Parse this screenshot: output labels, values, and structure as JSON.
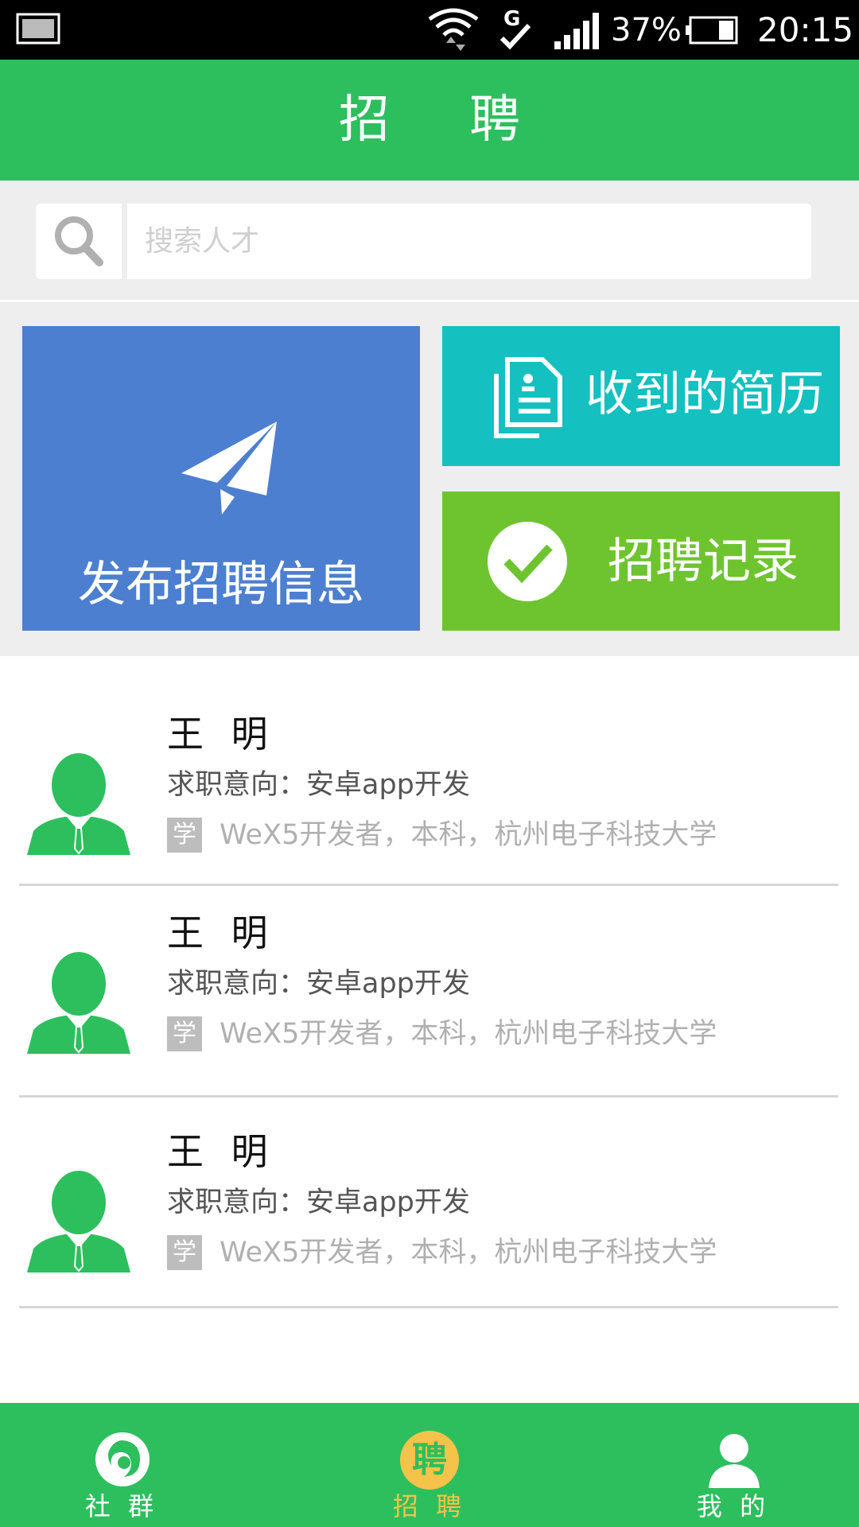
{
  "status_bar": {
    "battery_percent": "37%",
    "time": "20:15",
    "network": "G",
    "icons": [
      "screenshot-icon",
      "wifi-icon",
      "network-g-icon",
      "signal-icon",
      "battery-icon"
    ]
  },
  "header": {
    "title": "招 聘"
  },
  "search": {
    "placeholder": "搜索人才",
    "value": ""
  },
  "actions": {
    "publish": {
      "label": "发布招聘信息",
      "icon": "paper-plane-icon"
    },
    "received_resumes": {
      "label": "收到的简历",
      "icon": "document-icon"
    },
    "records": {
      "label": "招聘记录",
      "icon": "check-circle-icon"
    }
  },
  "candidates": [
    {
      "name": "王 明",
      "intent": "求职意向：安卓app开发",
      "badge": "学",
      "education": "WeX5开发者，本科，杭州电子科技大学"
    },
    {
      "name": "王 明",
      "intent": "求职意向：安卓app开发",
      "badge": "学",
      "education": "WeX5开发者，本科，杭州电子科技大学"
    },
    {
      "name": "王 明",
      "intent": "求职意向：安卓app开发",
      "badge": "学",
      "education": "WeX5开发者，本科，杭州电子科技大学"
    }
  ],
  "bottom_nav": [
    {
      "label": "社 群",
      "icon": "community-icon",
      "active": false
    },
    {
      "label": "招 聘",
      "icon": "recruit-icon",
      "badge_text": "聘",
      "active": true
    },
    {
      "label": "我 的",
      "icon": "profile-icon",
      "active": false
    }
  ],
  "colors": {
    "primary_green": "#2dbf5d",
    "publish_blue": "#4c7fd0",
    "resume_teal": "#14c0c0",
    "record_green": "#6ec42f",
    "active_nav": "#f5c24a"
  }
}
